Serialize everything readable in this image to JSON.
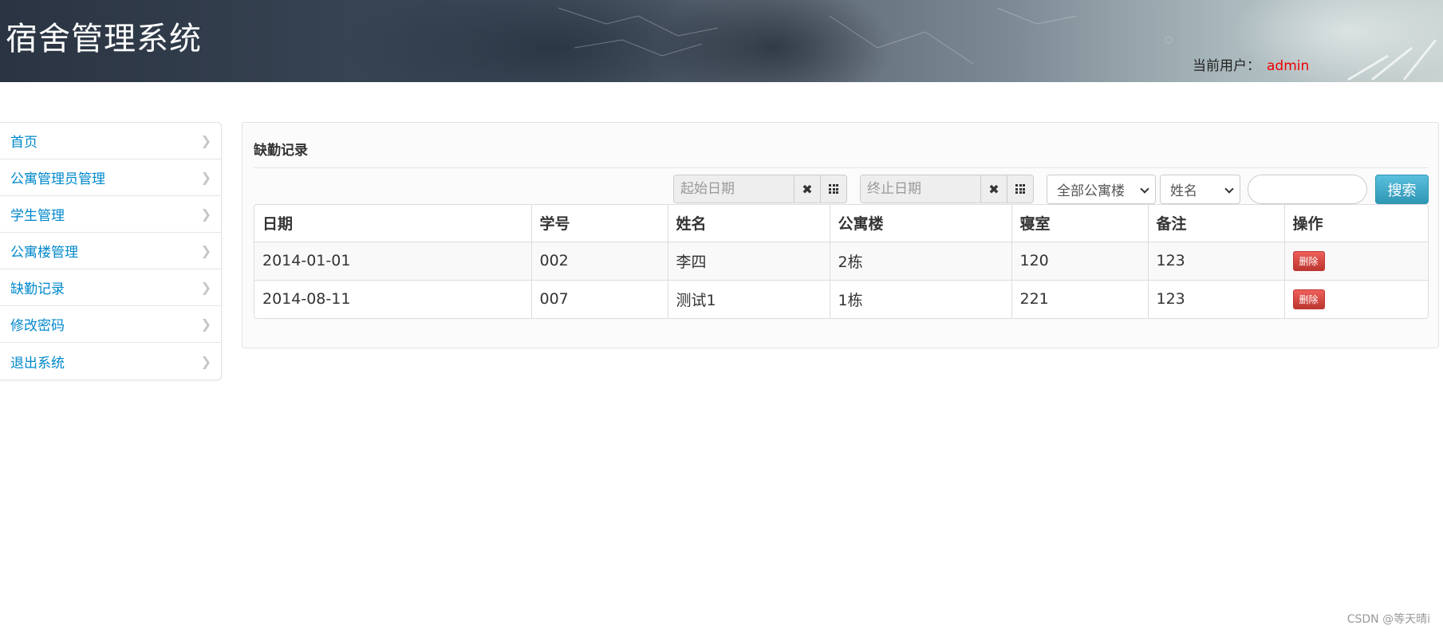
{
  "header": {
    "app_title": "宿舍管理系统",
    "current_user_label": "当前用户：",
    "username": "admin"
  },
  "sidebar": {
    "items": [
      {
        "label": "首页"
      },
      {
        "label": "公寓管理员管理"
      },
      {
        "label": "学生管理"
      },
      {
        "label": "公寓楼管理"
      },
      {
        "label": "缺勤记录"
      },
      {
        "label": "修改密码"
      },
      {
        "label": "退出系统"
      }
    ],
    "chevron_glyph": "❯"
  },
  "main": {
    "title": "缺勤记录",
    "toolbar": {
      "start_date_placeholder": "起始日期",
      "end_date_placeholder": "终止日期",
      "clear_glyph": "✖",
      "building_select_value": "全部公寓楼",
      "field_select_value": "姓名",
      "search_button_label": "搜索"
    },
    "table": {
      "columns": [
        "日期",
        "学号",
        "姓名",
        "公寓楼",
        "寝室",
        "备注",
        "操作"
      ],
      "rows": [
        {
          "date": "2014-01-01",
          "student_id": "002",
          "name": "李四",
          "building": "2栋",
          "room": "120",
          "remark": "123",
          "action": "删除"
        },
        {
          "date": "2014-08-11",
          "student_id": "007",
          "name": "测试1",
          "building": "1栋",
          "room": "221",
          "remark": "123",
          "action": "删除"
        }
      ]
    }
  },
  "footer": {
    "watermark": "CSDN @等天晴i"
  },
  "colors": {
    "link": "#0088cc",
    "username": "#ee0000",
    "search_button": "#2f96b4",
    "delete_button": "#bd362f"
  }
}
